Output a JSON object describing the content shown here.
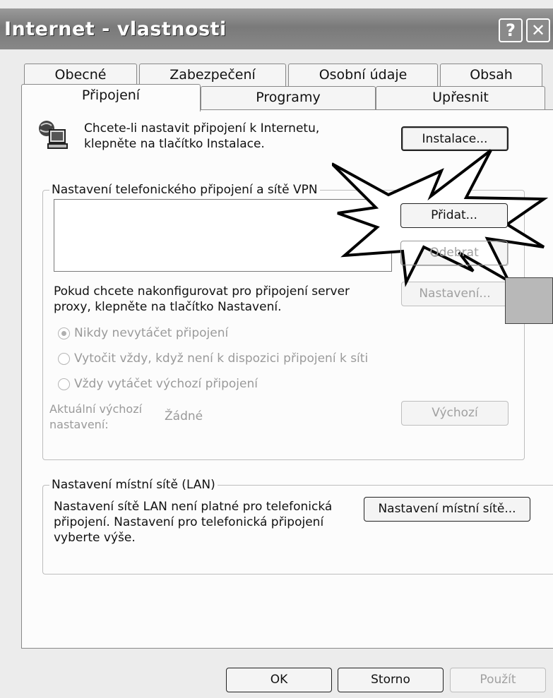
{
  "window": {
    "title": "Internet - vlastnosti",
    "help_label": "?",
    "close_label": "✕"
  },
  "tabs": {
    "back": [
      {
        "label": "Obecné"
      },
      {
        "label": "Zabezpečení"
      },
      {
        "label": "Osobní údaje"
      },
      {
        "label": "Obsah"
      }
    ],
    "front": [
      {
        "label": "Připojení",
        "active": true
      },
      {
        "label": "Programy"
      },
      {
        "label": "Upřesnit"
      }
    ]
  },
  "setup": {
    "line1": "Chcete-li nastavit připojení k Internetu,",
    "line2": "klepněte na tlačítko Instalace.",
    "install_button": "Instalace...",
    "icon": "network-computer-icon"
  },
  "dialup": {
    "legend": "Nastavení telefonického připojení a sítě VPN",
    "add_button": "Přidat...",
    "remove_button": "Odebrat",
    "settings_button": "Nastavení...",
    "proxy_line1": "Pokud chcete nakonfigurovat pro připojení server",
    "proxy_line2": "proxy, klepněte na tlačítko Nastavení.",
    "radio_never": "Nikdy nevytáčet připojení",
    "radio_whenever": "Vytočit vždy, když není k dispozici připojení k síti",
    "radio_always": "Vždy vytáčet výchozí připojení",
    "current_default_line1": "Aktuální výchozí",
    "current_default_line2": "nastavení:",
    "current_default_value": "Žádné",
    "default_button": "Výchozí"
  },
  "lan": {
    "legend": "Nastavení místní sítě (LAN)",
    "text_line1": "Nastavení sítě LAN není platné pro telefonická",
    "text_line2": "připojení. Nastavení pro telefonická připojení",
    "text_line3": "vyberte výše.",
    "lan_button": "Nastavení místní sítě..."
  },
  "footer": {
    "ok_button": "OK",
    "cancel_button": "Storno",
    "apply_button": "Použít"
  },
  "colors": {
    "titlebar": "#888888",
    "panel": "#fcfcfc",
    "disabled_text": "#9a9a9a"
  }
}
